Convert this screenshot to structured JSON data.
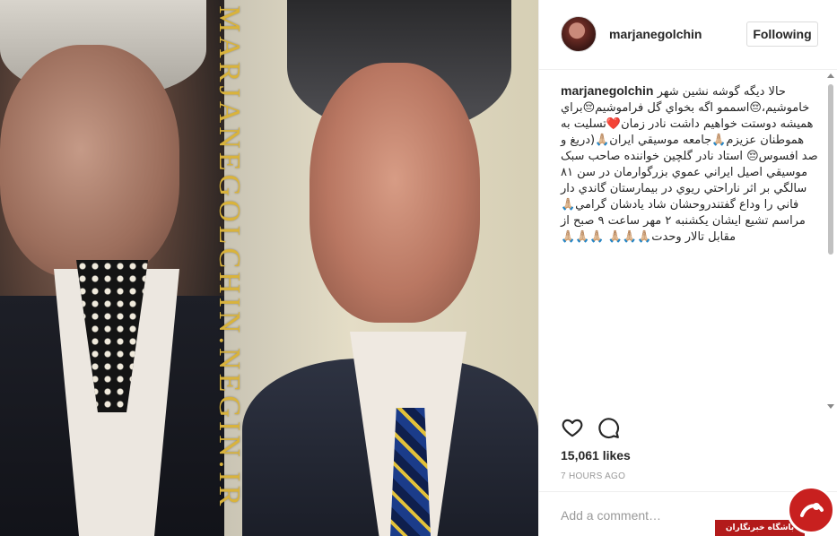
{
  "post": {
    "image": {
      "watermark_text": "MARJANEGOLCHIN.NEGIN.IR"
    }
  },
  "header": {
    "username": "marjanegolchin",
    "follow_label": "Following"
  },
  "caption": {
    "username": "marjanegolchin",
    "text": "حالا دیگه گوشه نشین شهر خاموشیم،😔اسممو اگه بخواي گل فراموشیم😔براي همیشه دوستت خواهیم داشت نادر زمان❤️تسلیت به هموطنان عزیزم🙏🏼جامعه موسیقي ایران🙏🏼(دریغ و صد افسوس😔 استاد نادر گلچین خواننده صاحب سبک موسیقي اصیل ایراني عموي بزرگوارمان در سن ۸۱ سالگي بر اثر ناراحتي ریوي در بیمارستان گاندي دار فاني را وداع گفتندروحشان شاد یادشان گرامي🙏🏼مراسم تشیع ایشان یکشنبه ۲ مهر ساعت ۹ صبح از مقابل تالار وحدت🙏🏼🙏🏼🙏🏼 🙏🏼🙏🏼🙏🏼"
  },
  "actions": {
    "like_icon": "heart-outline-icon",
    "comment_icon": "speech-bubble-icon"
  },
  "likes_text": "15,061 likes",
  "timestamp": "7 HOURS AGO",
  "comment_placeholder": "Add a comment…",
  "site_logo": {
    "label": "باشگاه خبرنگاران"
  },
  "colors": {
    "text_primary": "#262626",
    "text_secondary": "#999999",
    "border": "#efefef",
    "watermark_gold": "#d9b33c",
    "logo_red": "#c8201f"
  }
}
